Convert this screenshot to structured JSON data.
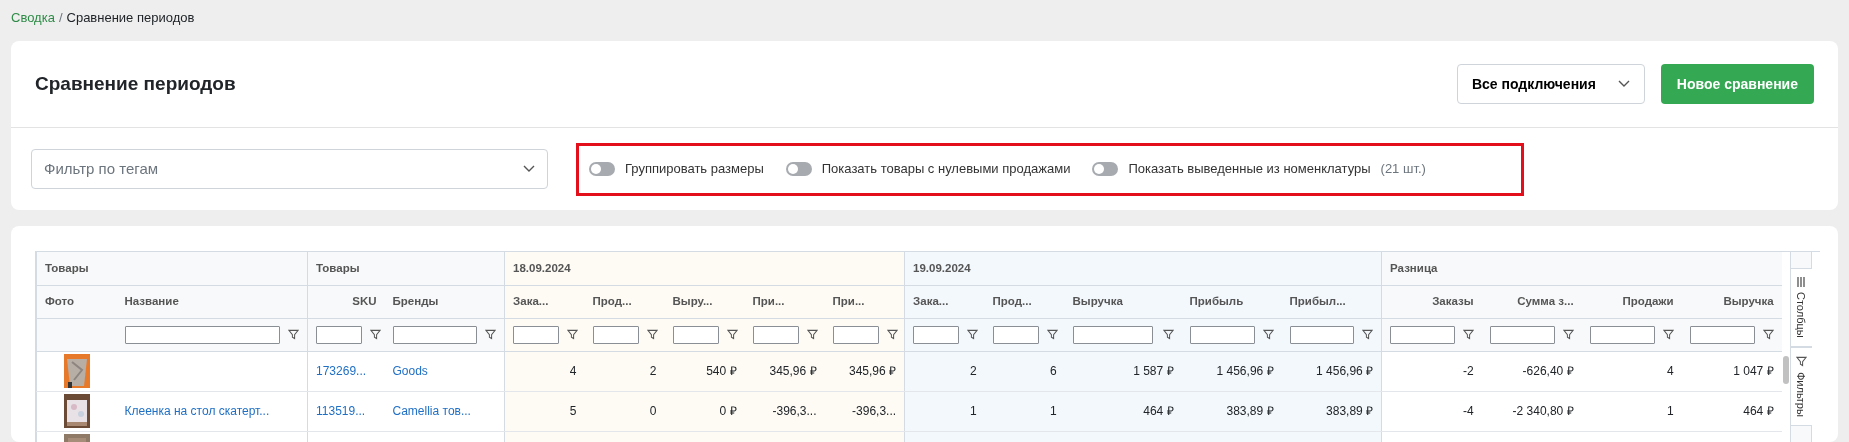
{
  "breadcrumb": [
    {
      "label": "Сводка",
      "link": true
    },
    {
      "label": "Сравнение периодов",
      "link": false
    }
  ],
  "breadcrumb_separator": "/",
  "header": {
    "title": "Сравнение периодов",
    "connections_select": "Все подключения",
    "new_button": "Новое сравнение"
  },
  "tag_filter": {
    "placeholder": "Фильтр по тегам"
  },
  "toggles": [
    {
      "label": "Группировать размеры",
      "on": false
    },
    {
      "label": "Показать товары с нулевыми продажами",
      "on": false
    },
    {
      "label": "Показать выведенные из номенклатуры",
      "note": "(21 шт.)",
      "on": false
    }
  ],
  "table": {
    "groups": [
      {
        "label": "Товары",
        "kind": "info",
        "color": "#f8f9fa",
        "columns": [
          {
            "label": "Фото",
            "filter": false
          },
          {
            "label": "Название",
            "kind": "text",
            "filter": true
          }
        ]
      },
      {
        "label": "Товары",
        "kind": "info",
        "color": "#f8f9fa",
        "columns": [
          {
            "label": "SKU",
            "kind": "sku",
            "filter": true
          },
          {
            "label": "Бренды",
            "kind": "text",
            "filter": true
          }
        ]
      },
      {
        "label": "18.09.2024",
        "kind": "period",
        "color": "#fdfbf4",
        "columns": [
          {
            "label": "Зака...",
            "kind": "number",
            "filter": true
          },
          {
            "label": "Прод...",
            "kind": "number",
            "filter": true
          },
          {
            "label": "Выру...",
            "kind": "number",
            "filter": true
          },
          {
            "label": "При...",
            "kind": "number",
            "filter": true
          },
          {
            "label": "При...",
            "kind": "number",
            "filter": true
          }
        ]
      },
      {
        "label": "19.09.2024",
        "kind": "period",
        "color": "#f3f8fd",
        "columns": [
          {
            "label": "Зака...",
            "kind": "number",
            "filter": true
          },
          {
            "label": "Прод...",
            "kind": "number",
            "filter": true
          },
          {
            "label": "Выручка",
            "kind": "number",
            "filter": true
          },
          {
            "label": "Прибыль",
            "kind": "number",
            "filter": true
          },
          {
            "label": "Прибыл...",
            "kind": "number",
            "filter": true
          }
        ]
      },
      {
        "label": "Разница",
        "kind": "diff",
        "color": "#f8f9fa",
        "columns": [
          {
            "label": "Заказы",
            "kind": "number",
            "filter": true
          },
          {
            "label": "Сумма з...",
            "kind": "number",
            "filter": true
          },
          {
            "label": "Продажи",
            "kind": "number",
            "filter": true
          },
          {
            "label": "Выручка",
            "kind": "number",
            "filter": true
          }
        ]
      }
    ],
    "rows": [
      {
        "cells": [
          {
            "kind": "picture"
          },
          "",
          "173269...",
          "Goods",
          "4",
          "2",
          "540 ₽",
          "345,96 ₽",
          "345,96 ₽",
          "2",
          "6",
          "1 587 ₽",
          "1 456,96 ₽",
          "1 456,96 ₽",
          "-2",
          "-626,40 ₽",
          "4",
          "1 047 ₽"
        ]
      },
      {
        "cells": [
          {
            "kind": "picture"
          },
          "Клеенка на стол скатерт...",
          "113519...",
          "Camellia тов...",
          "5",
          "0",
          "0 ₽",
          "-396,3...",
          "-396,3...",
          "1",
          "1",
          "464 ₽",
          "383,89 ₽",
          "383,89 ₽",
          "-4",
          "-2 340,80 ₽",
          "1",
          "464 ₽"
        ]
      },
      {
        "cells": [
          {
            "kind": "picture"
          }
        ]
      }
    ]
  },
  "side_tabs": [
    {
      "label": "Столбцы",
      "kind": "columns"
    },
    {
      "label": "Фильтры",
      "kind": "filters"
    }
  ]
}
